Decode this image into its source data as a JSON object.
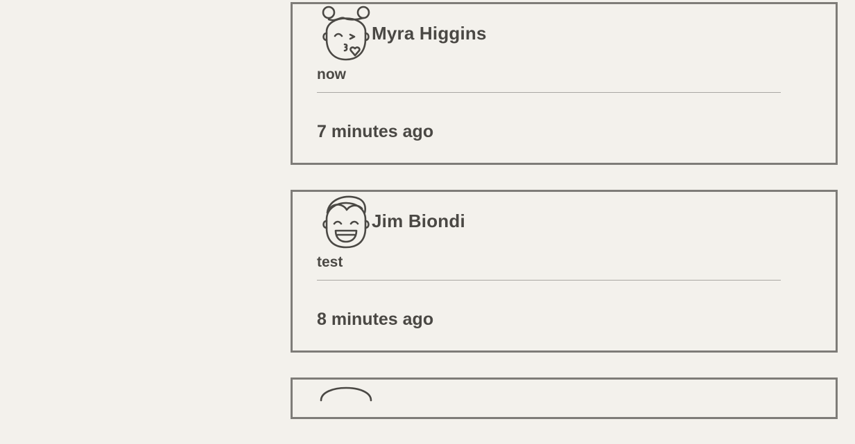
{
  "posts": [
    {
      "author": "Myra Higgins",
      "message": "now",
      "time": "7 minutes ago",
      "avatar_icon": "girl-kiss-face-icon"
    },
    {
      "author": "Jim Biondi",
      "message": "test",
      "time": "8 minutes ago",
      "avatar_icon": "boy-laughing-face-icon"
    },
    {
      "avatar_icon": "face-avatar-icon"
    }
  ],
  "colors": {
    "background": "#f3f1ec",
    "card_border": "#7e7c78",
    "text": "#4a4844",
    "divider": "#a9a7a3"
  }
}
